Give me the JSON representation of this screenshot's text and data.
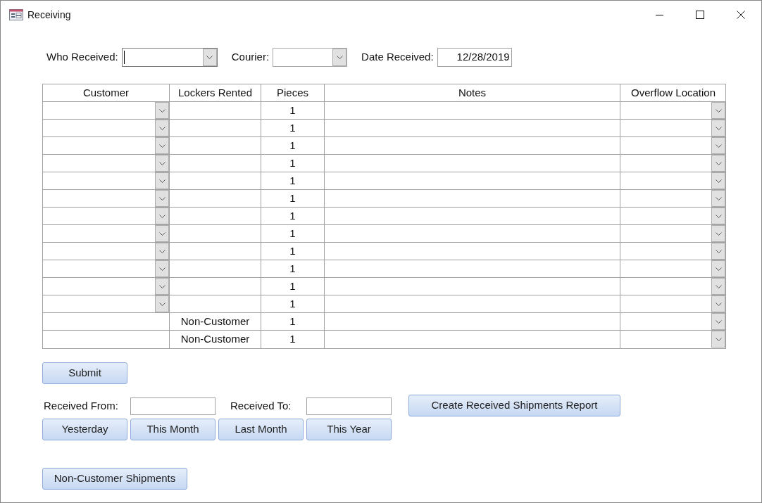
{
  "window": {
    "title": "Receiving"
  },
  "header_fields": [
    {
      "kind": "combo",
      "label": "Who Received:",
      "focused": true
    },
    {
      "kind": "combo",
      "label": "Courier:",
      "focused": false
    },
    {
      "kind": "text",
      "label": "Date Received:",
      "value": "12/28/2019",
      "focused": false
    }
  ],
  "table": {
    "columns": [
      "Customer",
      "Lockers Rented",
      "Pieces",
      "Notes",
      "Overflow Location"
    ],
    "rows": [
      {
        "kind": "customer",
        "lockers": "",
        "pieces": "1",
        "notes": ""
      },
      {
        "kind": "customer",
        "lockers": "",
        "pieces": "1",
        "notes": ""
      },
      {
        "kind": "customer",
        "lockers": "",
        "pieces": "1",
        "notes": ""
      },
      {
        "kind": "customer",
        "lockers": "",
        "pieces": "1",
        "notes": ""
      },
      {
        "kind": "customer",
        "lockers": "",
        "pieces": "1",
        "notes": ""
      },
      {
        "kind": "customer",
        "lockers": "",
        "pieces": "1",
        "notes": ""
      },
      {
        "kind": "customer",
        "lockers": "",
        "pieces": "1",
        "notes": ""
      },
      {
        "kind": "customer",
        "lockers": "",
        "pieces": "1",
        "notes": ""
      },
      {
        "kind": "customer",
        "lockers": "",
        "pieces": "1",
        "notes": ""
      },
      {
        "kind": "customer",
        "lockers": "",
        "pieces": "1",
        "notes": ""
      },
      {
        "kind": "customer",
        "lockers": "",
        "pieces": "1",
        "notes": ""
      },
      {
        "kind": "customer",
        "lockers": "",
        "pieces": "1",
        "notes": ""
      },
      {
        "kind": "non_customer",
        "lockers": "Non-Customer",
        "pieces": "1",
        "notes": ""
      },
      {
        "kind": "non_customer",
        "lockers": "Non-Customer",
        "pieces": "1",
        "notes": ""
      }
    ]
  },
  "submit_button": "Submit",
  "range": {
    "from_label": "Received From:",
    "to_label": "Received To:",
    "report_button": "Create Received Shipments Report",
    "quick_buttons": [
      "Yesterday",
      "This Month",
      "Last Month",
      "This Year"
    ]
  },
  "non_customer_button": "Non-Customer Shipments"
}
